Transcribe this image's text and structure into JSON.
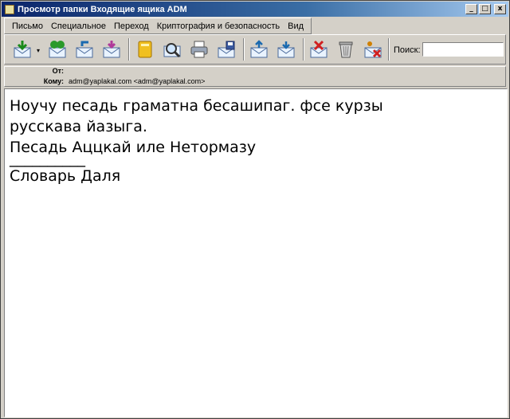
{
  "window": {
    "title": "Просмотр папки Входящие ящика ADM",
    "min_label": "_",
    "max_label": "□",
    "close_label": "x"
  },
  "menu": {
    "items": [
      {
        "label": "Письмо"
      },
      {
        "label": "Специальное"
      },
      {
        "label": "Переход"
      },
      {
        "label": "Криптография и безопасность"
      },
      {
        "label": "Вид"
      }
    ]
  },
  "toolbar": {
    "icons": [
      "get-mail-icon",
      "compose-icon",
      "reply-icon",
      "forward-icon",
      "address-book-icon",
      "find-icon",
      "print-icon",
      "save-icon",
      "prev-icon",
      "next-icon",
      "delete-icon",
      "trash-icon",
      "junk-icon"
    ],
    "dropdown_glyph": "▾",
    "search": {
      "label": "Поиск:",
      "value": ""
    }
  },
  "headers": {
    "from_label": "От:",
    "from_value": "",
    "to_label": "Кому:",
    "to_value": "adm@yaplakal.com <adm@yaplakal.com>"
  },
  "message": {
    "lines": [
      "Ноучу песадь граматна бесашипаг. фсе курзы",
      "русскава йазыга.",
      "Песадь Аццкай иле Нетормазу",
      "",
      "__________",
      "Словарь Даля"
    ]
  },
  "colors": {
    "titlebar_start": "#0a246a",
    "titlebar_end": "#a6caf0",
    "chrome": "#d4d0c8"
  }
}
